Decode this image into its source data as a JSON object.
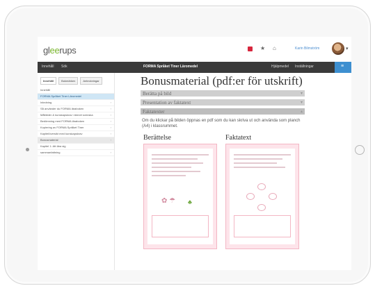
{
  "app": {
    "logo_prefix": "gl",
    "logo_accent": "ee",
    "logo_suffix": "rups",
    "user_name": "Karin Bilmström"
  },
  "nav": {
    "left_items": [
      "Innehåll",
      "Sök"
    ],
    "title": "FORMA Språket Tiner Läromedel",
    "right_items": [
      "Hjälpmedel",
      "Inställningar"
    ]
  },
  "sidebar": {
    "tabs": [
      "Innehåll",
      "Bokmärken",
      "Anteckningar"
    ],
    "items": [
      "Innehåll",
      "FORMA Språket Tiner Läromedel",
      "Inledning",
      "Så använder du FORMA läraboken",
      "Målbilder & kunskapskrav i ämnet svenska",
      "Bedömning med FORMA läraboken",
      "Kopiering av FORMA Språket Tiner",
      "Kapitelöversikt med kunskapskrav",
      "Bonusmaterial",
      "Kapitel 1: Att lära sig",
      "sammanfattning"
    ],
    "active_index": 1,
    "selected_index": 8
  },
  "main": {
    "title": "Bonusmaterial (pdf:er för utskrift)",
    "accordions": [
      "Berätta på bild",
      "Presentation av faktatext",
      "Faktatexter"
    ],
    "open_index": 2,
    "paragraph": "Om du klickar på bilden öppnas en pdf som du kan skriva ut och använda som planch (A4) i klassrummet.",
    "thumbnails": [
      "Berättelse",
      "Faktatext"
    ]
  },
  "colors": {
    "navbar_bg": "#3a3a3a",
    "accent_green": "#79b52d",
    "accent_blue": "#3d8fd0",
    "active_item_bg": "#cfe6f5",
    "page_pink": "#fde4ea"
  },
  "icons": [
    "notification-icon",
    "star-icon",
    "home-icon",
    "avatar",
    "chevron-down-icon",
    "menu-icon"
  ]
}
